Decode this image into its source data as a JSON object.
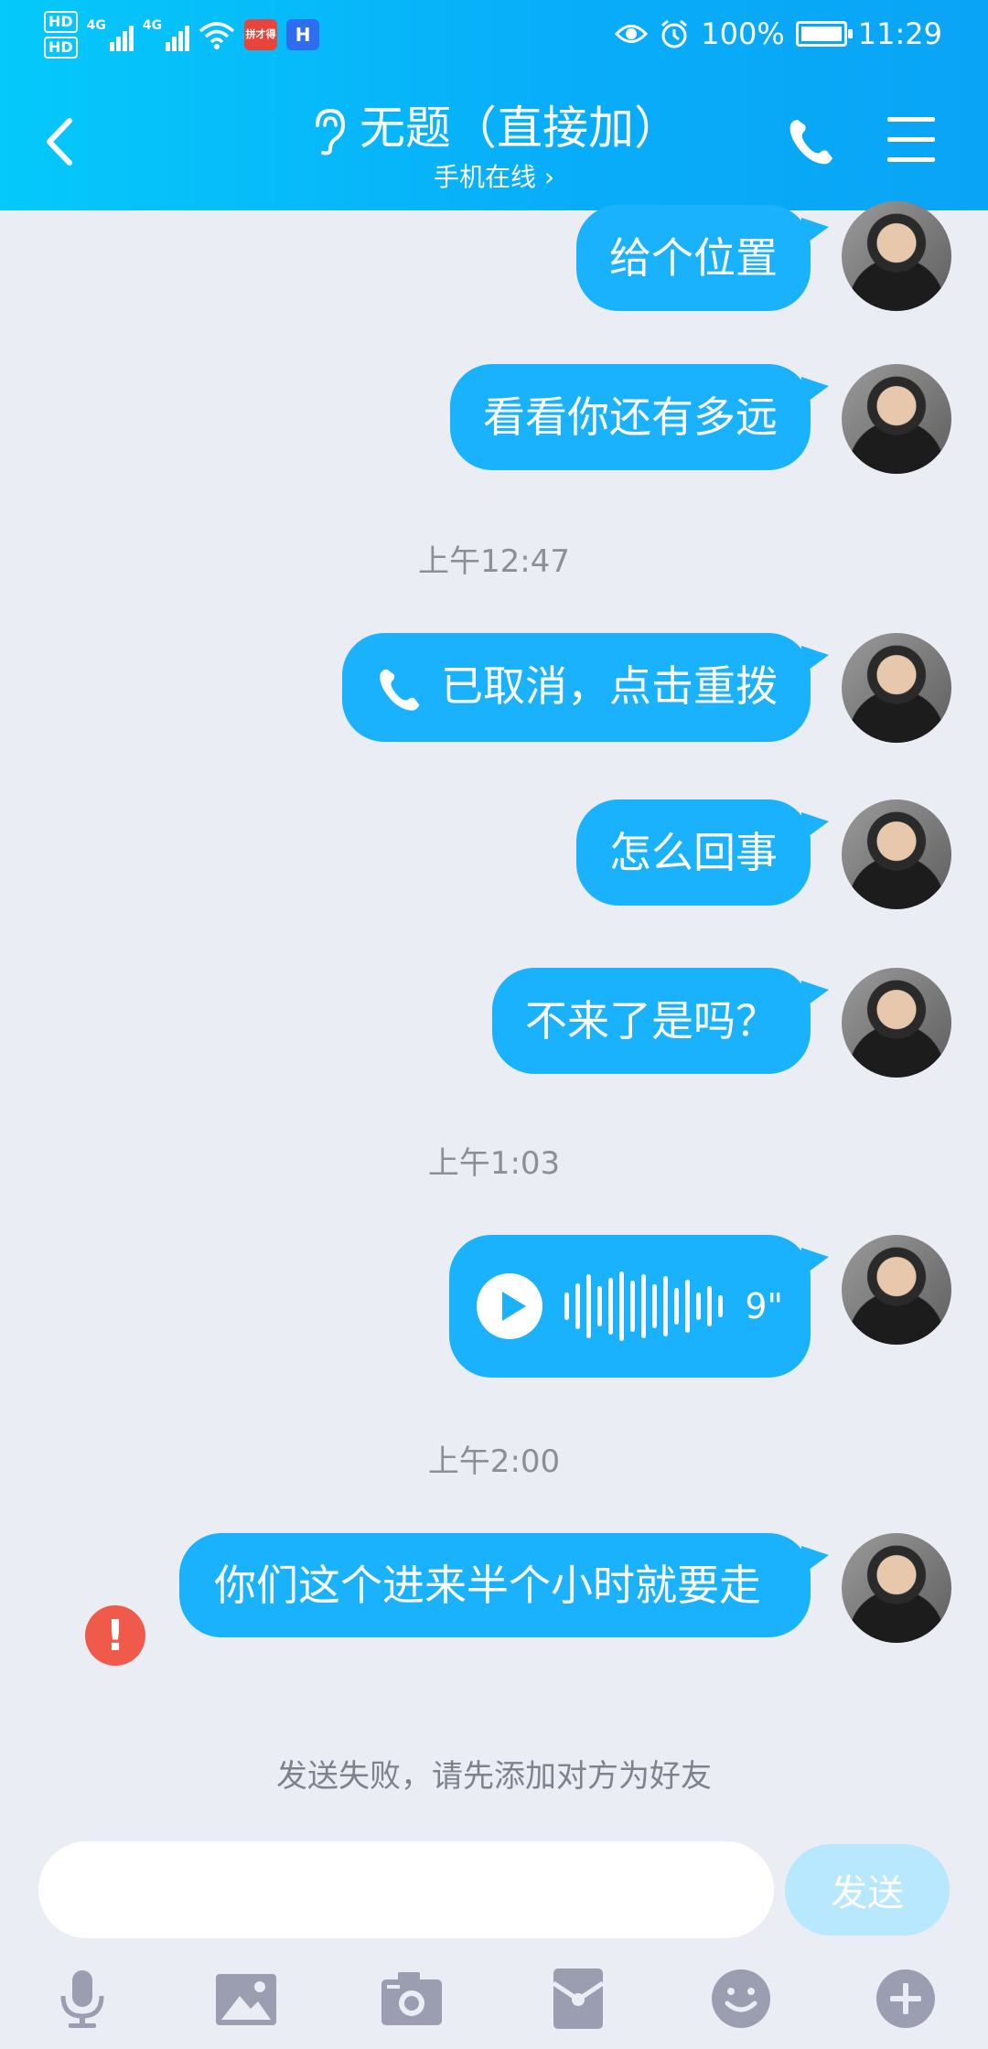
{
  "status_bar": {
    "hd1": "HD",
    "hd2": "HD",
    "sig1": "4G",
    "sig2": "4G",
    "app1_label": "拼才得",
    "app2_label": "H",
    "battery": "100%",
    "time": "11:29"
  },
  "header": {
    "title": "无题（直接加）",
    "subtitle": "手机在线 ›"
  },
  "messages": [
    {
      "type": "text",
      "text": "给个位置"
    },
    {
      "type": "text",
      "text": "看看你还有多远"
    },
    {
      "type": "time",
      "text": "上午12:47"
    },
    {
      "type": "call",
      "text": "已取消，点击重拨"
    },
    {
      "type": "text",
      "text": "怎么回事"
    },
    {
      "type": "text",
      "text": "不来了是吗？"
    },
    {
      "type": "time",
      "text": "上午1:03"
    },
    {
      "type": "voice",
      "duration": "9\""
    },
    {
      "type": "time",
      "text": "上午2:00"
    },
    {
      "type": "text_failed",
      "text": "你们这个进来半个小时就要走"
    }
  ],
  "fail_note": "发送失败，请先添加对方为好友",
  "error_mark": "!",
  "input": {
    "value": "",
    "placeholder": ""
  },
  "send_label": "发送",
  "toolbar": [
    "mic-icon",
    "image-icon",
    "camera-icon",
    "red-packet-icon",
    "emoji-icon",
    "plus-icon"
  ],
  "colors": {
    "header_start": "#05c9fa",
    "header_end": "#0aa4f6",
    "bubble": "#1ab2fc",
    "background": "#ebedf5",
    "error": "#f05a4a",
    "icon_gray": "#9a9eb0"
  }
}
